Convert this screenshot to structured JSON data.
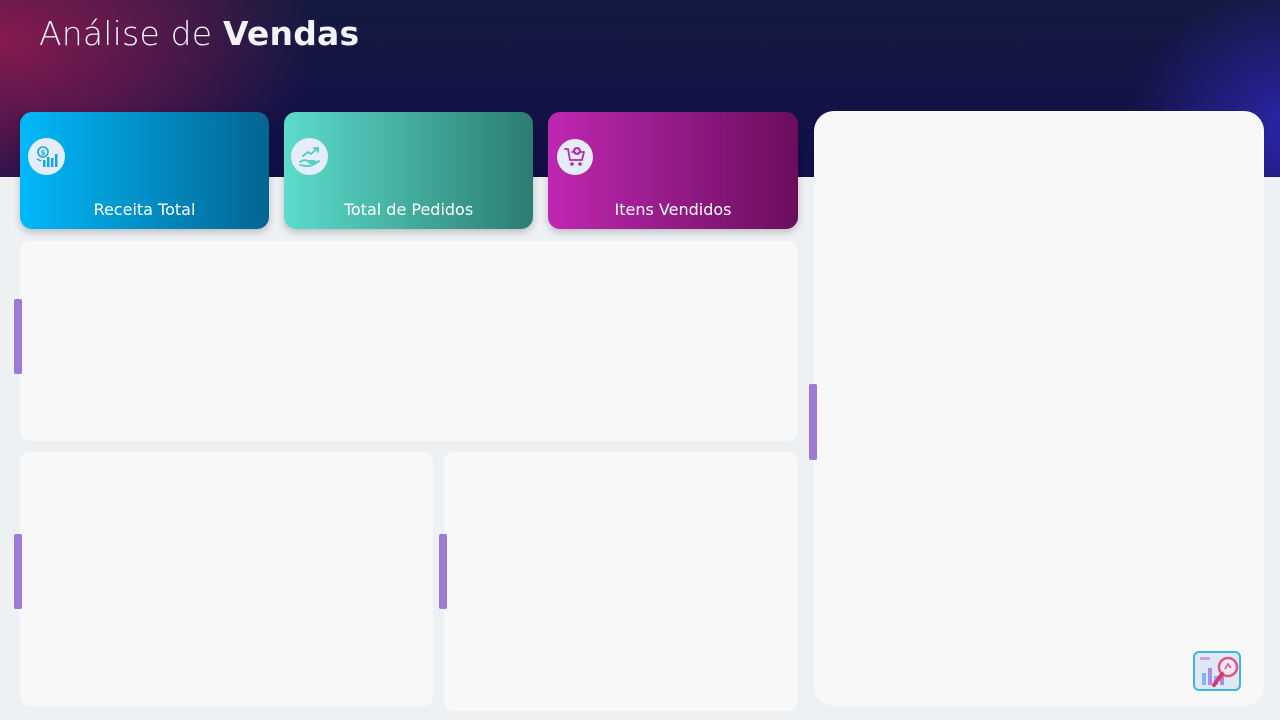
{
  "header": {
    "title_light": "Análise de",
    "title_bold": "Vendas"
  },
  "kpis": {
    "receita": {
      "label": "Receita Total",
      "icon": "revenue-chart-icon",
      "color_start": "#02b8fa",
      "color_end": "#036592"
    },
    "pedidos": {
      "label": "Total de Pedidos",
      "icon": "hand-growth-icon",
      "color_start": "#5bdccc",
      "color_end": "#2c7d70"
    },
    "itens": {
      "label": "Itens Vendidos",
      "icon": "shopping-cart-icon",
      "color_start": "#bf27b2",
      "color_end": "#6a0e5c"
    }
  },
  "colors": {
    "header_bg": "#120f4a",
    "page_bg": "#eef1f4",
    "panel_bg": "#f8f8f8",
    "handle": "#9c7ad6"
  },
  "logo": {
    "icon": "analytics-magnifier-logo"
  }
}
